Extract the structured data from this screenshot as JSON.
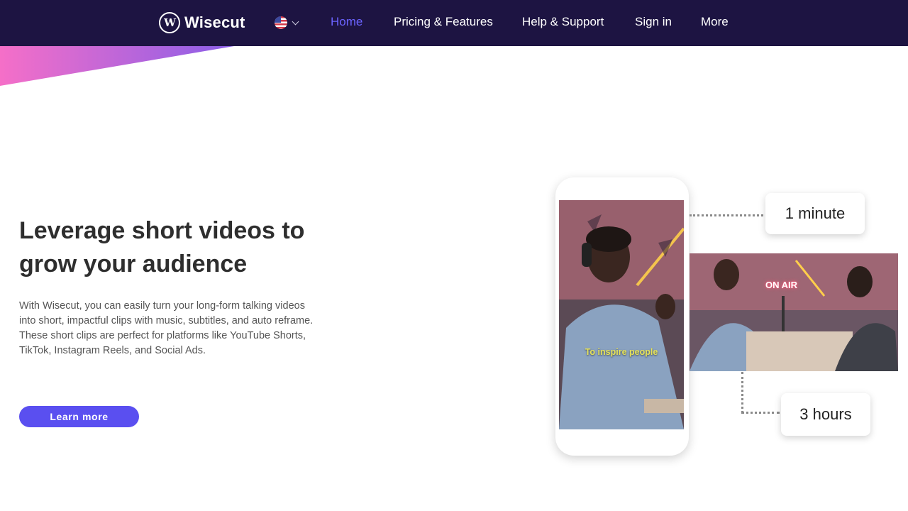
{
  "brand": {
    "name": "Wisecut",
    "logo_mark": "W"
  },
  "nav": {
    "language_icon": "us-flag-icon",
    "items": [
      {
        "label": "Home",
        "active": true
      },
      {
        "label": "Pricing & Features",
        "active": false
      },
      {
        "label": "Help & Support",
        "active": false
      },
      {
        "label": "Sign in",
        "active": false
      },
      {
        "label": "More",
        "active": false
      }
    ]
  },
  "hero": {
    "title": "Leverage short videos to grow your audience",
    "description": "With Wisecut, you can easily turn your long-form talking videos into short, impactful clips with music, subtitles, and auto reframe. These short clips are perfect for platforms like YouTube Shorts, TikTok, Instagram Reels, and Social Ads.",
    "cta_label": "Learn more"
  },
  "illustration": {
    "phone_caption": "To inspire people",
    "studio_sign": "ON AIR",
    "short_duration": "1 minute",
    "long_duration": "3 hours"
  },
  "colors": {
    "nav_bg": "#1d1442",
    "nav_active": "#6b63ff",
    "cta_bg": "#5a4ff0",
    "wedge_start": "#f56fc8",
    "wedge_end": "#8a5ee8"
  }
}
